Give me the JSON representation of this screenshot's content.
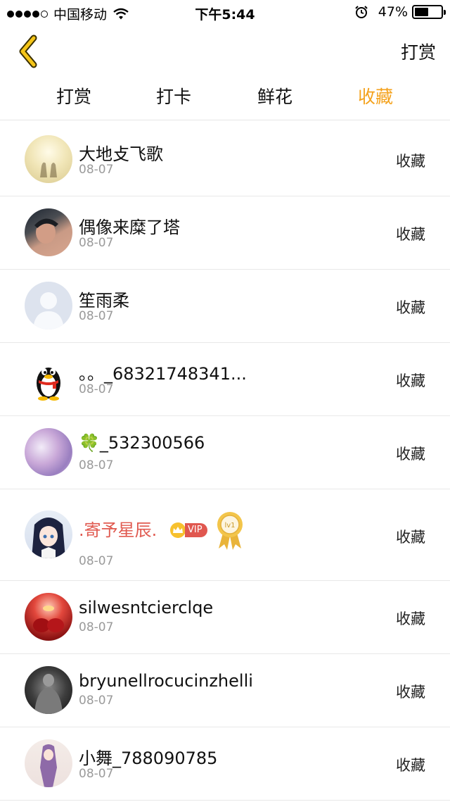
{
  "status_bar": {
    "carrier": "中国移动",
    "time": "下午5:44",
    "battery": "47%"
  },
  "nav": {
    "back_icon": "chevron-left-icon",
    "action_label": "打赏",
    "accent_color": "#f4a21d"
  },
  "tabs": [
    {
      "label": "打赏",
      "active": false
    },
    {
      "label": "打卡",
      "active": false
    },
    {
      "label": "鲜花",
      "active": false
    },
    {
      "label": "收藏",
      "active": true
    }
  ],
  "list": [
    {
      "name": "大地攴飞歌",
      "date": "08-07",
      "action": "收藏"
    },
    {
      "name": "偶像来糜了塔",
      "date": "08-07",
      "action": "收藏"
    },
    {
      "name": "笙雨柔",
      "date": "08-07",
      "action": "收藏"
    },
    {
      "name": "。。_68321748341...",
      "date": "08-07",
      "action": "收藏"
    },
    {
      "name": "🍀_532300566",
      "date": "08-07",
      "action": "收藏"
    },
    {
      "name": ".寄予星辰.",
      "date": "08-07",
      "action": "收藏",
      "vip_label": "VIP",
      "level_label": "lv1"
    },
    {
      "name": "silwesntcierclqe",
      "date": "08-07",
      "action": "收藏"
    },
    {
      "name": "bryunellrocucinzhelli",
      "date": "08-07",
      "action": "收藏"
    },
    {
      "name": "小舞_788090785",
      "date": "08-07",
      "action": "收藏"
    }
  ]
}
